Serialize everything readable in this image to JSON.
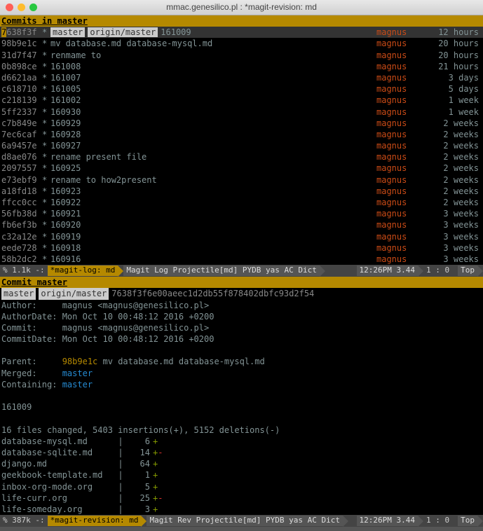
{
  "window": {
    "title": "mmac.genesilico.pl :  *magit-revision: md"
  },
  "log_panel": {
    "header": "Commits in master",
    "refs": {
      "master": "master",
      "origin": "origin/master",
      "msg": "161009"
    },
    "selected_hash": "7638f3f",
    "commits": [
      {
        "hash": "7638f3f",
        "msg": "",
        "author": "magnus",
        "age": "12 hours",
        "selected": true,
        "refrow": true
      },
      {
        "hash": "98b9e1c",
        "msg": "mv database.md database-mysql.md",
        "author": "magnus",
        "age": "20 hours"
      },
      {
        "hash": "31d7f47",
        "msg": "renmame to",
        "author": "magnus",
        "age": "20 hours"
      },
      {
        "hash": "0b898ce",
        "msg": "161008",
        "author": "magnus",
        "age": "21 hours"
      },
      {
        "hash": "d6621aa",
        "msg": "161007",
        "author": "magnus",
        "age": "3 days"
      },
      {
        "hash": "c618710",
        "msg": "161005",
        "author": "magnus",
        "age": "5 days"
      },
      {
        "hash": "c218139",
        "msg": "161002",
        "author": "magnus",
        "age": "1 week"
      },
      {
        "hash": "5ff2337",
        "msg": "160930",
        "author": "magnus",
        "age": "1 week"
      },
      {
        "hash": "c7b849e",
        "msg": "160929",
        "author": "magnus",
        "age": "2 weeks"
      },
      {
        "hash": "7ec6caf",
        "msg": "160928",
        "author": "magnus",
        "age": "2 weeks"
      },
      {
        "hash": "6a9457e",
        "msg": "160927",
        "author": "magnus",
        "age": "2 weeks"
      },
      {
        "hash": "d8ae076",
        "msg": "rename present file",
        "author": "magnus",
        "age": "2 weeks"
      },
      {
        "hash": "2097557",
        "msg": "160925",
        "author": "magnus",
        "age": "2 weeks"
      },
      {
        "hash": "e73ebf9",
        "msg": "rename to how2present",
        "author": "magnus",
        "age": "2 weeks"
      },
      {
        "hash": "a18fd18",
        "msg": "160923",
        "author": "magnus",
        "age": "2 weeks"
      },
      {
        "hash": "ffcc0cc",
        "msg": "160922",
        "author": "magnus",
        "age": "2 weeks"
      },
      {
        "hash": "56fb38d",
        "msg": "160921",
        "author": "magnus",
        "age": "3 weeks"
      },
      {
        "hash": "fb6ef3b",
        "msg": "160920",
        "author": "magnus",
        "age": "3 weeks"
      },
      {
        "hash": "c32a12e",
        "msg": "160919",
        "author": "magnus",
        "age": "3 weeks"
      },
      {
        "hash": "eede728",
        "msg": "160918",
        "author": "magnus",
        "age": "3 weeks"
      },
      {
        "hash": "58b2dc2",
        "msg": "160916",
        "author": "magnus",
        "age": "3 weeks"
      }
    ],
    "modeline": {
      "left": "% 1.1k -: ",
      "buf": "*magit-log: md",
      "major": "Magit Log Projectile[md] PYDB yas AC Dict",
      "time": "12:26PM 3.44",
      "pos": "1 : 0",
      "loc": "Top"
    }
  },
  "rev_panel": {
    "header": "Commit master",
    "refs": {
      "master": "master",
      "origin": "origin/master",
      "sha": "7638f3f6e00aeec1d2db55f878402dbfc93d2f54"
    },
    "meta": {
      "author_label": "Author:     ",
      "author": "magnus <magnus@genesilico.pl>",
      "authordate_label": "AuthorDate: ",
      "authordate": "Mon Oct 10 00:48:12 2016 +0200",
      "commit_label": "Commit:     ",
      "commit": "magnus <magnus@genesilico.pl>",
      "commitdate_label": "CommitDate: ",
      "commitdate": "Mon Oct 10 00:48:12 2016 +0200",
      "parent_label": "Parent:     ",
      "parent_hash": "98b9e1c",
      "parent_msg": "mv database.md database-mysql.md",
      "merged_label": "Merged:     ",
      "merged": "master",
      "containing_label": "Containing: ",
      "containing": "master"
    },
    "commit_msg": "161009",
    "summary": "16 files changed, 5403 insertions(+), 5152 deletions(-)",
    "diffstat": [
      {
        "file": "database-mysql.md",
        "num": "6",
        "pm": "+"
      },
      {
        "file": "database-sqlite.md",
        "num": "14",
        "pm": "+-"
      },
      {
        "file": "django.md",
        "num": "64",
        "pm": "+"
      },
      {
        "file": "geekbook-template.md",
        "num": "1",
        "pm": "+"
      },
      {
        "file": "inbox-org-mode.org",
        "num": "5",
        "pm": "+"
      },
      {
        "file": "life-curr.org",
        "num": "25",
        "pm": "+-"
      },
      {
        "file": "life-someday.org",
        "num": "3",
        "pm": "+"
      }
    ],
    "modeline": {
      "left": "% 387k -: ",
      "buf": "*magit-revision: md",
      "major": "Magit Rev Projectile[md] PYDB yas AC Dict",
      "time": "12:26PM 3.44",
      "pos": "1 : 0",
      "loc": "Top"
    }
  }
}
